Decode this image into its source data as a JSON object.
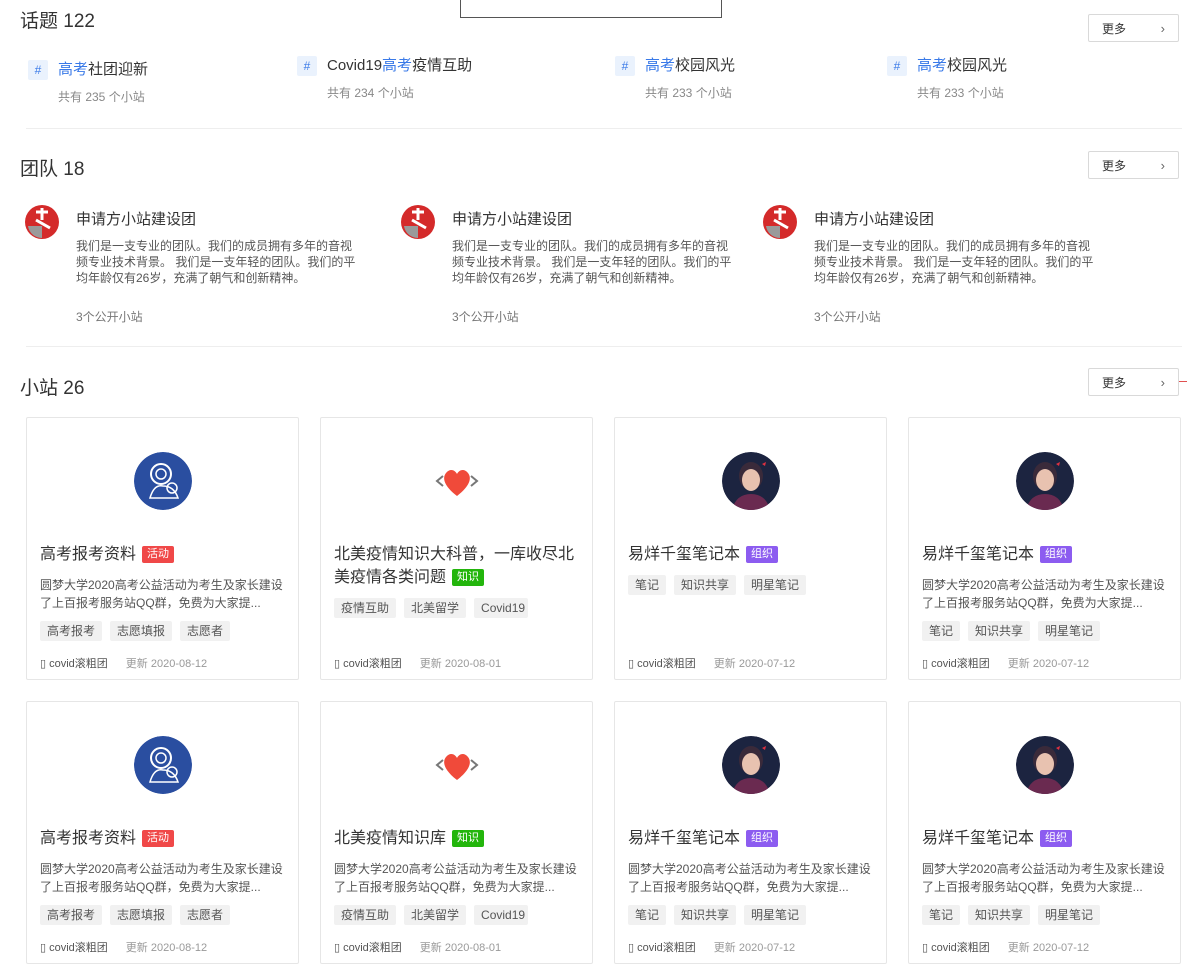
{
  "topics": {
    "title": "话题 122",
    "more": "更多",
    "items": [
      {
        "hl": "高考",
        "rest": "社团迎新",
        "count": "共有 235 个小站"
      },
      {
        "pre": "Covid19",
        "hl": "高考",
        "rest": "疫情互助",
        "count": "共有 234 个小站"
      },
      {
        "hl": "高考",
        "rest": "校园风光",
        "count": "共有 233 个小站"
      },
      {
        "hl": "高考",
        "rest": "校园风光",
        "count": "共有 233 个小站"
      }
    ]
  },
  "teams": {
    "title": "团队 18",
    "more": "更多",
    "items": [
      {
        "name": "申请方小站建设团",
        "desc": "我们是一支专业的团队。我们的成员拥有多年的音视频专业技术背景。 我们是一支年轻的团队。我们的平均年龄仅有26岁，充满了朝气和创新精神。",
        "sites": "3个公开小站"
      },
      {
        "name": "申请方小站建设团",
        "desc": "我们是一支专业的团队。我们的成员拥有多年的音视频专业技术背景。 我们是一支年轻的团队。我们的平均年龄仅有26岁，充满了朝气和创新精神。",
        "sites": "3个公开小站"
      },
      {
        "name": "申请方小站建设团",
        "desc": "我们是一支专业的团队。我们的成员拥有多年的音视频专业技术背景。 我们是一支年轻的团队。我们的平均年龄仅有26岁，充满了朝气和创新精神。",
        "sites": "3个公开小站"
      }
    ]
  },
  "sites": {
    "title": "小站 26",
    "more": "更多",
    "cards": [
      {
        "title": "高考报考资料",
        "badge": "活动",
        "desc": "圆梦大学2020高考公益活动为考生及家长建设了上百报考服务站QQ群，免费为大家提...",
        "tags": [
          "高考报考",
          "志愿填报",
          "志愿者"
        ],
        "author": "covid滚粗团",
        "updated": "更新 2020-08-12"
      },
      {
        "title": "北美疫情知识大科普，一库收尽北美疫情各类问题",
        "badge": "知识",
        "desc": "",
        "tags": [
          "疫情互助",
          "北美留学",
          "Covid19"
        ],
        "author": "covid滚粗团",
        "updated": "更新 2020-08-01"
      },
      {
        "title": "易烊千玺笔记本",
        "badge": "组织",
        "desc": "",
        "tags": [
          "笔记",
          "知识共享",
          "明星笔记"
        ],
        "author": "covid滚粗团",
        "updated": "更新 2020-07-12"
      },
      {
        "title": "易烊千玺笔记本",
        "badge": "组织",
        "desc": "圆梦大学2020高考公益活动为考生及家长建设了上百报考服务站QQ群，免费为大家提...",
        "tags": [
          "笔记",
          "知识共享",
          "明星笔记"
        ],
        "author": "covid滚粗团",
        "updated": "更新 2020-07-12"
      },
      {
        "title": "高考报考资料",
        "badge": "活动",
        "desc": "圆梦大学2020高考公益活动为考生及家长建设了上百报考服务站QQ群，免费为大家提...",
        "tags": [
          "高考报考",
          "志愿填报",
          "志愿者"
        ],
        "author": "covid滚粗团",
        "updated": "更新 2020-08-12"
      },
      {
        "title": "北美疫情知识库",
        "badge": "知识",
        "desc": "圆梦大学2020高考公益活动为考生及家长建设了上百报考服务站QQ群，免费为大家提...",
        "tags": [
          "疫情互助",
          "北美留学",
          "Covid19"
        ],
        "author": "covid滚粗团",
        "updated": "更新 2020-08-01"
      },
      {
        "title": "易烊千玺笔记本",
        "badge": "组织",
        "desc": "圆梦大学2020高考公益活动为考生及家长建设了上百报考服务站QQ群，免费为大家提...",
        "tags": [
          "笔记",
          "知识共享",
          "明星笔记"
        ],
        "author": "covid滚粗团",
        "updated": "更新 2020-07-12"
      },
      {
        "title": "易烊千玺笔记本",
        "badge": "组织",
        "desc": "圆梦大学2020高考公益活动为考生及家长建设了上百报考服务站QQ群，免费为大家提...",
        "tags": [
          "笔记",
          "知识共享",
          "明星笔记"
        ],
        "author": "covid滚粗团",
        "updated": "更新 2020-07-12"
      }
    ]
  },
  "colors": {
    "accent": "#3a7ae8",
    "badge_activity": "#f04848",
    "badge_knowledge": "#23b50c",
    "badge_org": "#8c5cf0"
  }
}
